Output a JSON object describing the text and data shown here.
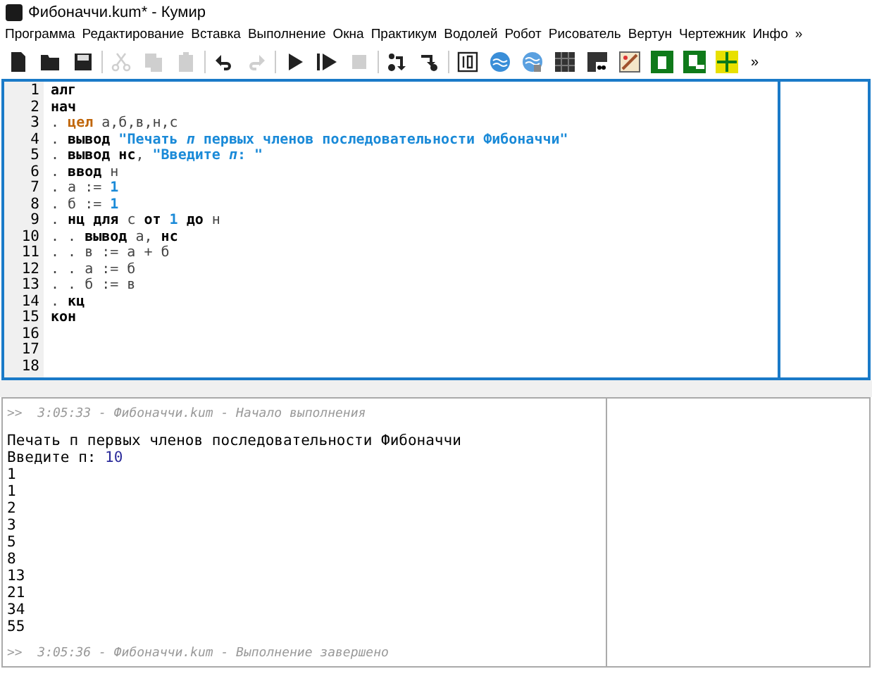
{
  "window": {
    "title": "Фибоначчи.kum* - Кумир"
  },
  "menu": [
    "Программа",
    "Редактирование",
    "Вставка",
    "Выполнение",
    "Окна",
    "Практикум",
    "Водолей",
    "Робот",
    "Рисователь",
    "Вертун",
    "Чертежник",
    "Инфо",
    "»"
  ],
  "toolbar": {
    "buttons": [
      {
        "kind": "new",
        "disabled": false
      },
      {
        "kind": "open",
        "disabled": false
      },
      {
        "kind": "save",
        "disabled": false
      },
      {
        "kind": "cut",
        "disabled": true
      },
      {
        "kind": "copy",
        "disabled": true
      },
      {
        "kind": "paste",
        "disabled": true
      },
      {
        "kind": "undo",
        "disabled": false
      },
      {
        "kind": "redo",
        "disabled": true
      },
      {
        "kind": "run",
        "disabled": false
      },
      {
        "kind": "run-steps",
        "disabled": false
      },
      {
        "kind": "stop",
        "disabled": true
      },
      {
        "kind": "step-over",
        "disabled": false
      },
      {
        "kind": "step-into",
        "disabled": false
      },
      {
        "kind": "io",
        "disabled": false
      },
      {
        "kind": "water",
        "disabled": false
      },
      {
        "kind": "water2",
        "disabled": false
      },
      {
        "kind": "grid",
        "disabled": false
      },
      {
        "kind": "robot",
        "disabled": false
      },
      {
        "kind": "paint",
        "disabled": false
      },
      {
        "kind": "green1",
        "disabled": false
      },
      {
        "kind": "green2",
        "disabled": false
      },
      {
        "kind": "plot",
        "disabled": false
      }
    ],
    "more": "»"
  },
  "editor": {
    "lines": [
      {
        "number": "1",
        "tokens": [
          {
            "kind": "keyword",
            "text": "алг"
          }
        ]
      },
      {
        "number": "2",
        "tokens": [
          {
            "kind": "keyword",
            "text": "нач"
          }
        ]
      },
      {
        "number": "3",
        "tokens": [
          {
            "kind": "plain",
            "text": ". "
          },
          {
            "kind": "type",
            "text": "цел"
          },
          {
            "kind": "plain",
            "text": " а,б,в,н,с"
          }
        ]
      },
      {
        "number": "4",
        "tokens": [
          {
            "kind": "plain",
            "text": ". "
          },
          {
            "kind": "keyword",
            "text": "вывод"
          },
          {
            "kind": "string",
            "text": " \"Печать *п* первых членов последовательности Фибоначчи\""
          }
        ]
      },
      {
        "number": "5",
        "tokens": [
          {
            "kind": "plain",
            "text": ". "
          },
          {
            "kind": "keyword",
            "text": "вывод нс"
          },
          {
            "kind": "plain",
            "text": ", "
          },
          {
            "kind": "string",
            "text": "\"Введите *п*: \""
          }
        ]
      },
      {
        "number": "6",
        "tokens": [
          {
            "kind": "plain",
            "text": ". "
          },
          {
            "kind": "keyword",
            "text": "ввод"
          },
          {
            "kind": "plain",
            "text": " н"
          }
        ]
      },
      {
        "number": "7",
        "tokens": [
          {
            "kind": "plain",
            "text": ". а := "
          },
          {
            "kind": "number",
            "text": "1"
          }
        ]
      },
      {
        "number": "8",
        "tokens": [
          {
            "kind": "plain",
            "text": ". б := "
          },
          {
            "kind": "number",
            "text": "1"
          }
        ]
      },
      {
        "number": "9",
        "tokens": [
          {
            "kind": "plain",
            "text": ". "
          },
          {
            "kind": "keyword",
            "text": "нц для"
          },
          {
            "kind": "plain",
            "text": " с "
          },
          {
            "kind": "keyword",
            "text": "от"
          },
          {
            "kind": "number",
            "text": " 1 "
          },
          {
            "kind": "keyword",
            "text": "до"
          },
          {
            "kind": "plain",
            "text": " н"
          }
        ]
      },
      {
        "number": "10",
        "tokens": [
          {
            "kind": "plain",
            "text": ". . "
          },
          {
            "kind": "keyword",
            "text": "вывод"
          },
          {
            "kind": "plain",
            "text": " а, "
          },
          {
            "kind": "keyword",
            "text": "нс"
          }
        ]
      },
      {
        "number": "11",
        "tokens": [
          {
            "kind": "plain",
            "text": ". . в := а + б"
          }
        ]
      },
      {
        "number": "12",
        "tokens": [
          {
            "kind": "plain",
            "text": ". . а := б"
          }
        ]
      },
      {
        "number": "13",
        "tokens": [
          {
            "kind": "plain",
            "text": ". . б := в"
          }
        ]
      },
      {
        "number": "14",
        "tokens": [
          {
            "kind": "plain",
            "text": ". "
          },
          {
            "kind": "keyword",
            "text": "кц"
          }
        ]
      },
      {
        "number": "15",
        "tokens": [
          {
            "kind": "keyword",
            "text": "кон"
          }
        ]
      },
      {
        "number": "16"
      },
      {
        "number": "17"
      },
      {
        "number": "18"
      }
    ]
  },
  "console": {
    "lines": [
      {
        "kind": "log",
        "text": ">>  3:05:33 - Фибоначчи.kum - Начало выполнения"
      },
      {
        "kind": "blank"
      },
      {
        "kind": "output",
        "text": "Печать п первых членов последовательности Фибоначчи"
      },
      {
        "kind": "input",
        "text": "Введите п: ",
        "value": "10"
      },
      {
        "kind": "output",
        "text": "1"
      },
      {
        "kind": "output",
        "text": "1"
      },
      {
        "kind": "output",
        "text": "2"
      },
      {
        "kind": "output",
        "text": "3"
      },
      {
        "kind": "output",
        "text": "5"
      },
      {
        "kind": "output",
        "text": "8"
      },
      {
        "kind": "output",
        "text": "13"
      },
      {
        "kind": "output",
        "text": "21"
      },
      {
        "kind": "output",
        "text": "34"
      },
      {
        "kind": "output",
        "text": "55"
      },
      {
        "kind": "blank"
      },
      {
        "kind": "log",
        "text": ">>  3:05:36 - Фибоначчи.kum - Выполнение завершено"
      }
    ]
  }
}
